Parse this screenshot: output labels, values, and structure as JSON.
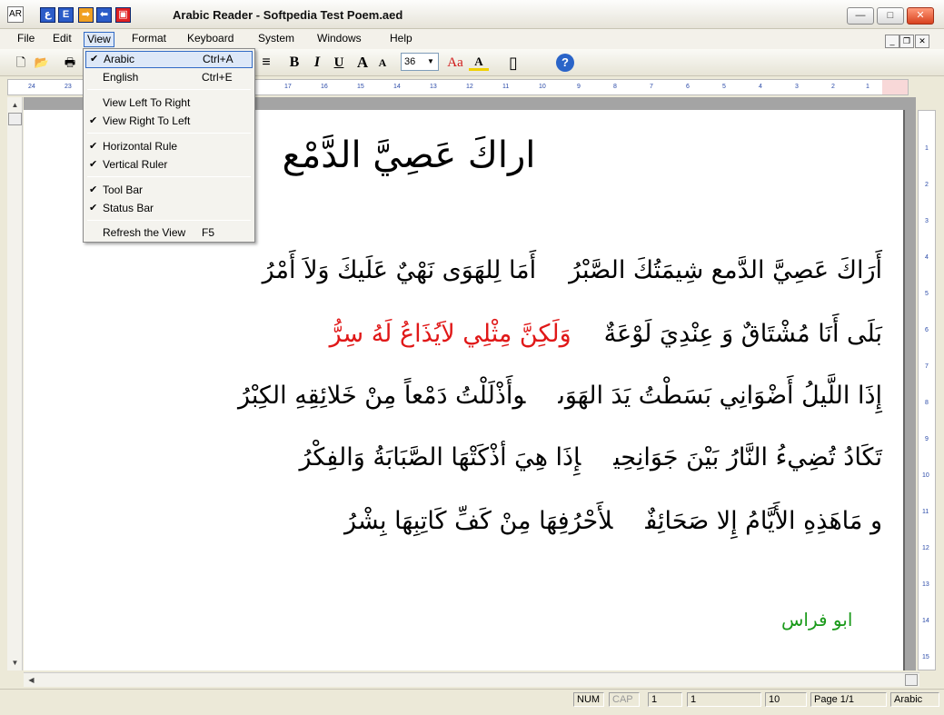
{
  "window": {
    "title": "Arabic Reader - Softpedia Test Poem.aed",
    "quick_buttons": [
      "ع",
      "E",
      "➡",
      "⬅",
      "▣"
    ],
    "controls": {
      "minimize": "—",
      "maximize": "□",
      "close": "✕"
    }
  },
  "menubar": {
    "items": [
      "File",
      "Edit",
      "View",
      "Format",
      "Keyboard",
      "System",
      "Windows",
      "Help"
    ],
    "mdi_controls": [
      "_",
      "❐",
      "✕"
    ]
  },
  "view_menu": {
    "arabic": {
      "label": "Arabic",
      "shortcut": "Ctrl+A",
      "check": "✔"
    },
    "english": {
      "label": "English",
      "shortcut": "Ctrl+E",
      "check": ""
    },
    "left_to_right": {
      "label": "View Left To Right",
      "check": ""
    },
    "right_to_left": {
      "label": "View Right To Left",
      "check": "✔"
    },
    "horizontal_rule": {
      "label": "Horizontal Rule",
      "check": "✔"
    },
    "vertical_ruler": {
      "label": "Vertical Ruler",
      "check": "✔"
    },
    "tool_bar": {
      "label": "Tool Bar",
      "check": "✔"
    },
    "status_bar": {
      "label": "Status Bar",
      "check": "✔"
    },
    "refresh": {
      "label": "Refresh the View",
      "shortcut": "F5"
    }
  },
  "toolbar": {
    "new": "🗋",
    "open": "📂",
    "print": "🖶",
    "align": "≡",
    "bold": "B",
    "italic": "I",
    "underline": "U",
    "grow": "A",
    "shrink": "A",
    "font_size": "36",
    "dropdown_arrow": "▼",
    "font_color": "Aa",
    "highlight": "A",
    "page_icon": "▯",
    "help": "?"
  },
  "ruler": {
    "h_ticks": [
      "24",
      "23",
      "17",
      "16",
      "15",
      "14",
      "13",
      "12",
      "11",
      "10",
      "9",
      "8",
      "7",
      "6",
      "5",
      "4",
      "3",
      "2",
      "1"
    ],
    "v_ticks": [
      "1",
      "2",
      "3",
      "4",
      "5",
      "6",
      "7",
      "8",
      "9",
      "10",
      "11",
      "12",
      "13",
      "14",
      "15"
    ]
  },
  "document": {
    "title": "اراكَ عَصِيَّ الدَّمْع",
    "verses": [
      {
        "first": "أَرَاكَ عَصِيَّ الدَّمع شِيمَتُكَ الصَّبْرُ",
        "second": "أَمَا لِلهَوَى نَهْيٌ عَلَيكَ وَلاَ أَمْرُ"
      },
      {
        "first": "بَلَى أَنَا مُشْتَاقٌ وَ عِنْدِيَ لَوْعَةٌ",
        "second": "وَلَكِنَّ مِثْلِي لاَيُذَاعُ لَهُ سِرُّ"
      },
      {
        "first": "إِذَا اللَّيلُ أَضْوَانِي بَسَطْتُ يَدَ الهَوَى",
        "second": "وأَذْلَلْتُ دَمْعاً مِنْ خَلائِقِهِ الكِبْرُ"
      },
      {
        "first": "تَكَادُ تُضِيءُ النَّارُ بَيْنَ جَوَانِحِي",
        "second": "إِذَا هِيَ أذْكَتْهَا الصَّبَابَةُ وَالفِكْرُ"
      },
      {
        "first": "و مَاهَذِهِ الأَيَّامُ إِلا صَحَائِفٌ",
        "second": "لأَحْرُفِهَا مِنْ كَفِّ كَاتِبِهَا بِشْرُ"
      }
    ],
    "author": "ابو فراس",
    "colors": {
      "accent_red": "#e01818",
      "author_green": "#1a9a1a"
    }
  },
  "statusbar": {
    "num": "NUM",
    "cap": "CAP",
    "field1": "1",
    "field2": "1",
    "field3": "10",
    "page": "Page 1/1",
    "language": "Arabic"
  }
}
